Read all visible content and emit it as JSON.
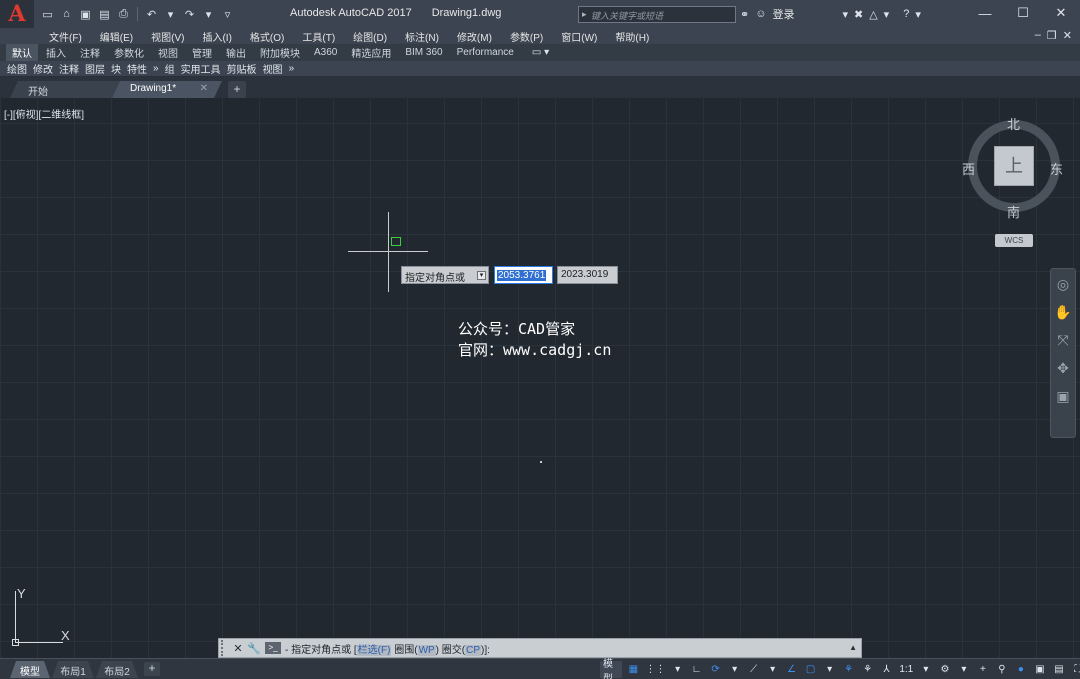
{
  "titlebar": {
    "app_name": "Autodesk AutoCAD 2017",
    "file_name": "Drawing1.dwg",
    "search_placeholder": "键入关键字或短语",
    "login_label": "登录",
    "logo_letter": "A"
  },
  "menu": [
    "文件(F)",
    "编辑(E)",
    "视图(V)",
    "插入(I)",
    "格式(O)",
    "工具(T)",
    "绘图(D)",
    "标注(N)",
    "修改(M)",
    "参数(P)",
    "窗口(W)",
    "帮助(H)"
  ],
  "ribbon_tabs": [
    "默认",
    "插入",
    "注释",
    "参数化",
    "视图",
    "管理",
    "输出",
    "附加模块",
    "A360",
    "精选应用",
    "BIM 360",
    "Performance"
  ],
  "ribbon_active": "默认",
  "panels": [
    "绘图",
    "修改",
    "注释",
    "图层",
    "块",
    "特性",
    "»",
    "组",
    "实用工具",
    "剪贴板",
    "视图",
    "»"
  ],
  "file_tabs": {
    "start": "开始",
    "drawing": "Drawing1*"
  },
  "viewport_label": "[-][俯视][二维线框]",
  "dynamic_input": {
    "prompt": "指定对角点或",
    "x_value": "2053.3761",
    "y_value": "2023.3019"
  },
  "watermark": {
    "line1": "公众号：CAD管家",
    "line2": "官网：www.cadgj.cn"
  },
  "viewcube": {
    "north": "北",
    "south": "南",
    "east": "东",
    "west": "西",
    "face": "上",
    "wcs": "WCS"
  },
  "ucs": {
    "x_label": "X",
    "y_label": "Y"
  },
  "command_line": {
    "prefix": "- 指定对角点或 [",
    "opt1": "栏选(F)",
    "opt2_pre": " 圈围(",
    "opt2_key": "WP",
    "opt2_post": ") 圈交(",
    "opt3_key": "CP",
    "suffix": ")]:"
  },
  "layout_tabs": [
    "模型",
    "布局1",
    "布局2"
  ],
  "status": {
    "model": "模型",
    "scale": "1:1"
  },
  "colors": {
    "canvas_bg": "#212830",
    "accent_blue": "#2f6fd1",
    "logo_red": "#e03a2f"
  }
}
